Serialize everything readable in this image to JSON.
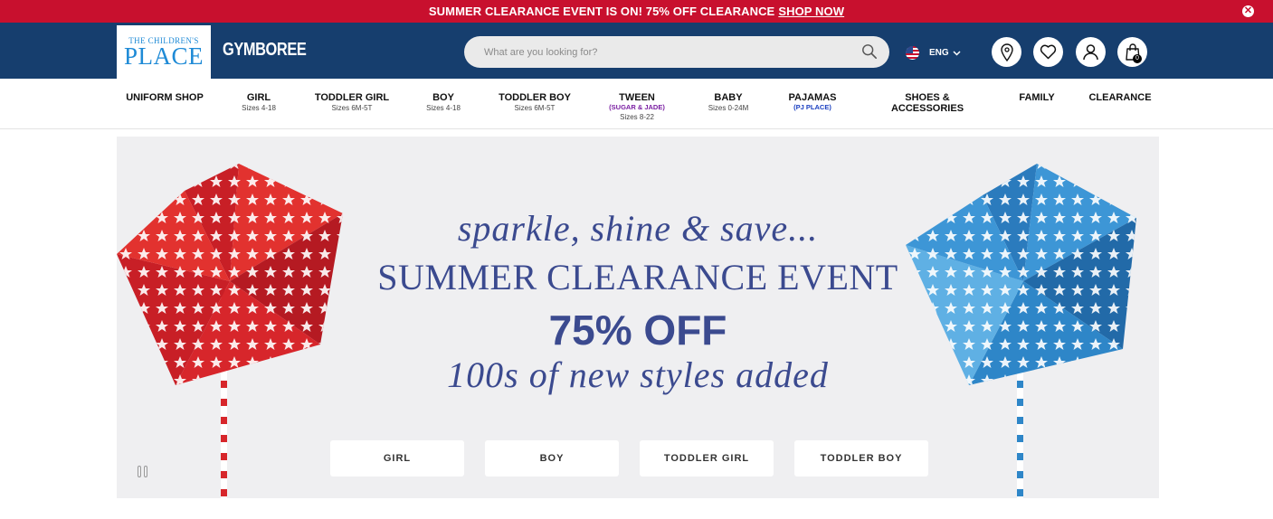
{
  "promo": {
    "text": "SUMMER CLEARANCE EVENT IS ON! 75% OFF CLEARANCE",
    "link": "SHOP NOW",
    "close": "✕"
  },
  "header": {
    "logo_small": "THE CHILDREN'S",
    "logo_big": "PLACE",
    "brand2": "GYMBOREE",
    "search_placeholder": "What are you looking for?",
    "language": "ENG",
    "cart_count": "0"
  },
  "nav": [
    {
      "label": "UNIFORM SHOP",
      "sub": ""
    },
    {
      "label": "GIRL",
      "sub": "Sizes 4-18"
    },
    {
      "label": "TODDLER GIRL",
      "sub": "Sizes 6M-5T"
    },
    {
      "label": "BOY",
      "sub": "Sizes 4-18"
    },
    {
      "label": "TODDLER BOY",
      "sub": "Sizes 6M-5T"
    },
    {
      "label": "TWEEN",
      "tag": "(SUGAR & JADE)",
      "sub": "Sizes 8-22"
    },
    {
      "label": "BABY",
      "sub": "Sizes 0-24M"
    },
    {
      "label": "PAJAMAS",
      "tag": "(PJ PLACE)",
      "sub": ""
    },
    {
      "label": "SHOES &",
      "label2": "ACCESSORIES"
    },
    {
      "label": "FAMILY"
    },
    {
      "label": "CLEARANCE"
    }
  ],
  "hero": {
    "line1": "sparkle, shine & save...",
    "line2": "SUMMER CLEARANCE EVENT",
    "line3": "75% OFF",
    "line4": "100s of new styles added",
    "buttons": [
      "GIRL",
      "BOY",
      "TODDLER GIRL",
      "TODDLER BOY"
    ]
  },
  "colors": {
    "promo_bg": "#c8102e",
    "header_bg": "#163e6e",
    "hero_text": "#3b4a8f",
    "pinwheel_red": "#d7262b",
    "pinwheel_blue": "#2e86c8"
  },
  "icons": [
    "close-icon",
    "search-icon",
    "us-flag-icon",
    "chevron-down-icon",
    "location-pin-icon",
    "heart-icon",
    "user-icon",
    "shopping-bag-icon",
    "pause-icon"
  ]
}
